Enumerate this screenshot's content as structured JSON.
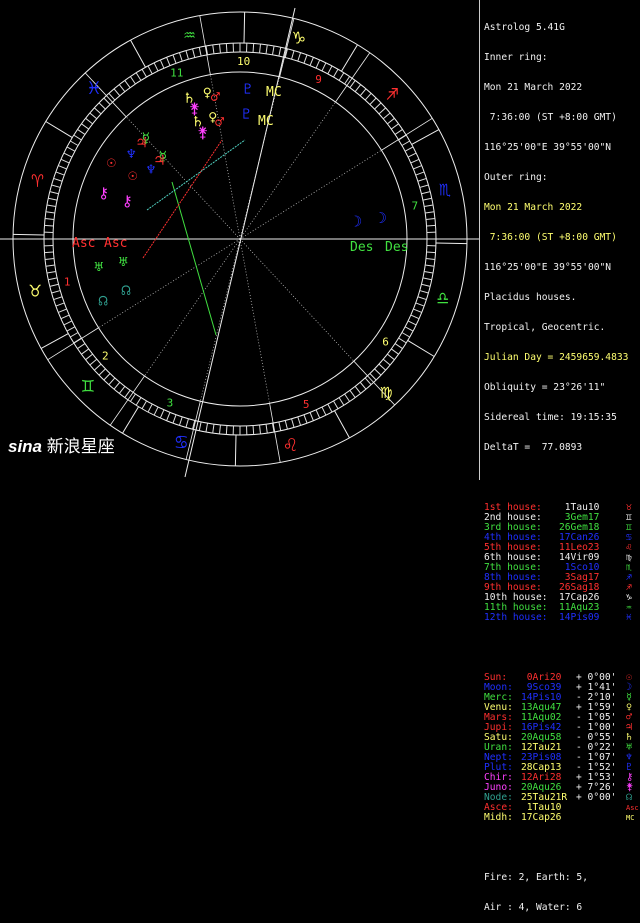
{
  "header": {
    "app": "Astrolog 5.41G",
    "inner_label": "Inner ring:",
    "inner_date": "Mon 21 March 2022",
    "inner_time": " 7:36:00 (ST +8:00 GMT)",
    "inner_loc": "116°25'00\"E 39°55'00\"N",
    "outer_label": "Outer ring:",
    "outer_date": "Mon 21 March 2022",
    "outer_time": " 7:36:00 (ST +8:00 GMT)",
    "outer_loc": "116°25'00\"E 39°55'00\"N",
    "houses": "Placidus houses.",
    "zodiac": "Tropical, Geocentric.",
    "julian": "Julian Day = 2459659.4833",
    "obliquity": "Obliquity = 23°26'11\"",
    "sidereal": "Sidereal time: 19:15:35",
    "deltat": "DeltaT =  77.0893"
  },
  "houses": [
    {
      "label": "1st house:",
      "pos": " 1Tau10",
      "glyph": "♉",
      "c": "r",
      "pc": "w",
      "gc": "r"
    },
    {
      "label": "2nd house:",
      "pos": " 3Gem17",
      "glyph": "♊",
      "c": "w",
      "pc": "g",
      "gc": "w"
    },
    {
      "label": "3rd house:",
      "pos": "26Gem18",
      "glyph": "♊",
      "c": "g",
      "pc": "g",
      "gc": "g"
    },
    {
      "label": "4th house:",
      "pos": "17Can26",
      "glyph": "♋",
      "c": "b",
      "pc": "b",
      "gc": "b"
    },
    {
      "label": "5th house:",
      "pos": "11Leo23",
      "glyph": "♌",
      "c": "r",
      "pc": "r",
      "gc": "r"
    },
    {
      "label": "6th house:",
      "pos": "14Vir09",
      "glyph": "♍",
      "c": "w",
      "pc": "w",
      "gc": "w"
    },
    {
      "label": "7th house:",
      "pos": " 1Sco10",
      "glyph": "♏",
      "c": "g",
      "pc": "b",
      "gc": "g"
    },
    {
      "label": "8th house:",
      "pos": " 3Sag17",
      "glyph": "♐",
      "c": "b",
      "pc": "r",
      "gc": "b"
    },
    {
      "label": "9th house:",
      "pos": "26Sag18",
      "glyph": "♐",
      "c": "r",
      "pc": "r",
      "gc": "r"
    },
    {
      "label": "10th house:",
      "pos": "17Cap26",
      "glyph": "♑",
      "c": "w",
      "pc": "w",
      "gc": "w"
    },
    {
      "label": "11th house:",
      "pos": "11Aqu23",
      "glyph": "♒",
      "c": "g",
      "pc": "g",
      "gc": "g"
    },
    {
      "label": "12th house:",
      "pos": "14Pis09",
      "glyph": "♓",
      "c": "b",
      "pc": "b",
      "gc": "b"
    }
  ],
  "planets": [
    {
      "label": "Sun:",
      "pos": " 0Ari20",
      "speed": "+ 0°00'",
      "glyph": "☉",
      "c": "r",
      "pc": "r",
      "gc": "r"
    },
    {
      "label": "Moon:",
      "pos": " 9Sco39",
      "speed": "+ 1°41'",
      "glyph": "☽",
      "c": "b",
      "pc": "b",
      "gc": "b"
    },
    {
      "label": "Merc:",
      "pos": "14Pis10",
      "speed": "- 2°10'",
      "glyph": "☿",
      "c": "g",
      "pc": "b",
      "gc": "g"
    },
    {
      "label": "Venu:",
      "pos": "13Aqu47",
      "speed": "+ 1°59'",
      "glyph": "♀",
      "c": "y",
      "pc": "g",
      "gc": "y"
    },
    {
      "label": "Mars:",
      "pos": "11Aqu02",
      "speed": "- 1°05'",
      "glyph": "♂",
      "c": "r",
      "pc": "g",
      "gc": "r"
    },
    {
      "label": "Jupi:",
      "pos": "16Pis42",
      "speed": "- 1°00'",
      "glyph": "♃",
      "c": "r",
      "pc": "b",
      "gc": "r"
    },
    {
      "label": "Satu:",
      "pos": "20Aqu58",
      "speed": "- 0°55'",
      "glyph": "♄",
      "c": "y",
      "pc": "g",
      "gc": "y"
    },
    {
      "label": "Uran:",
      "pos": "12Tau21",
      "speed": "- 0°22'",
      "glyph": "♅",
      "c": "g",
      "pc": "y",
      "gc": "g"
    },
    {
      "label": "Nept:",
      "pos": "23Pis08",
      "speed": "- 1°07'",
      "glyph": "♆",
      "c": "b",
      "pc": "b",
      "gc": "b"
    },
    {
      "label": "Plut:",
      "pos": "28Cap13",
      "speed": "- 1°52'",
      "glyph": "♇",
      "c": "b",
      "pc": "y",
      "gc": "b"
    },
    {
      "label": "Chir:",
      "pos": "12Ari28",
      "speed": "+ 1°53'",
      "glyph": "⚷",
      "c": "m",
      "pc": "r",
      "gc": "m"
    },
    {
      "label": "Juno:",
      "pos": "20Aqu26",
      "speed": "+ 7°26'",
      "glyph": "⚵",
      "c": "m",
      "pc": "g",
      "gc": "m"
    },
    {
      "label": "Node:",
      "pos": "25Tau21R",
      "speed": "+ 0°00'",
      "glyph": "☊",
      "c": "t",
      "pc": "y",
      "gc": "t"
    },
    {
      "label": "Asce:",
      "pos": " 1Tau10",
      "speed": "",
      "glyph": "Asc",
      "c": "r",
      "pc": "y",
      "gc": "r"
    },
    {
      "label": "Midh:",
      "pos": "17Cap26",
      "speed": "",
      "glyph": "MC",
      "c": "y",
      "pc": "y",
      "gc": "y"
    }
  ],
  "elements": {
    "line1": "Fire: 2, Earth: 5,",
    "line2": "Air : 4, Water: 6"
  },
  "wheel": {
    "signs": [
      {
        "g": "♒",
        "c": "#40e040"
      },
      {
        "g": "♑",
        "c": "#ffff70"
      },
      {
        "g": "♐",
        "c": "#ff3030"
      },
      {
        "g": "♏",
        "c": "#2030ff"
      },
      {
        "g": "♎",
        "c": "#40e040"
      },
      {
        "g": "♍",
        "c": "#ffff70"
      },
      {
        "g": "♌",
        "c": "#ff3030"
      },
      {
        "g": "♋",
        "c": "#2030ff"
      },
      {
        "g": "♊",
        "c": "#40e040"
      },
      {
        "g": "♉",
        "c": "#ffff70"
      },
      {
        "g": "♈",
        "c": "#ff3030"
      },
      {
        "g": "♓",
        "c": "#2030ff"
      }
    ],
    "house_numbers": [
      {
        "n": "10",
        "c": "#ffff70"
      },
      {
        "n": "11",
        "c": "#40e040"
      },
      {
        "n": "9",
        "c": "#ff3030"
      },
      {
        "n": "7",
        "c": "#40e040"
      },
      {
        "n": "6",
        "c": "#ffff70"
      },
      {
        "n": "5",
        "c": "#ff3030"
      },
      {
        "n": "3",
        "c": "#40e040"
      },
      {
        "n": "2",
        "c": "#ffff70"
      },
      {
        "n": "1",
        "c": "#ff3030"
      }
    ],
    "asc": "Asc",
    "des": "Des",
    "mc": "MC"
  },
  "watermark": {
    "brand": "sina",
    "text": "新浪星座"
  }
}
